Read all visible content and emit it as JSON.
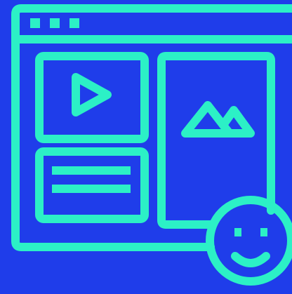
{
  "illustration": {
    "colors": {
      "background": "#1f3dea",
      "stroke": "#2cf0c6"
    },
    "icons": {
      "window": "browser-window-icon",
      "video": "play-icon",
      "image": "mountain-image-icon",
      "text": "text-lines-icon",
      "face": "smiley-face-icon"
    }
  }
}
